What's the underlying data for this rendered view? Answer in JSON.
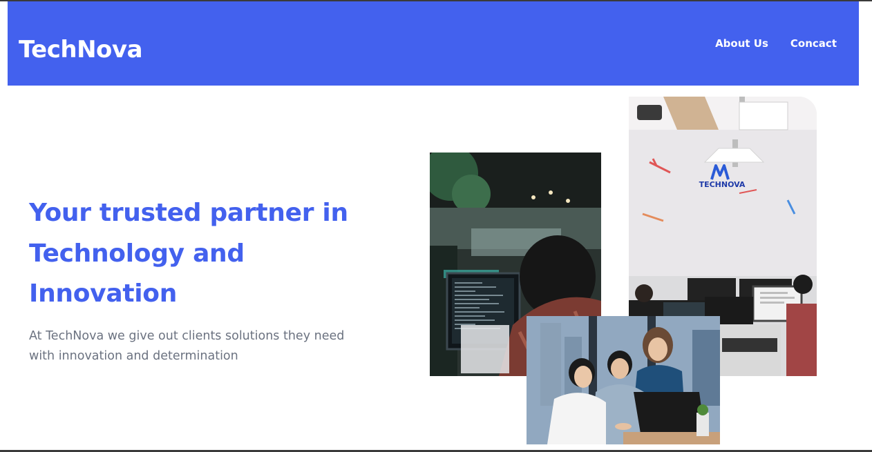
{
  "brand": {
    "name": "TechNova"
  },
  "nav": {
    "items": [
      {
        "label": "About Us"
      },
      {
        "label": "Concact"
      }
    ]
  },
  "hero": {
    "title": "Your trusted partner in Technology and Innovation",
    "subtitle": "At TechNova we give out clients solutions they need with innovation and determination"
  },
  "images": {
    "office_logo_text": "TECHNOVA",
    "office_logo_mark": "N"
  },
  "colors": {
    "primary": "#4361ee",
    "nav_text": "#ffffff",
    "body_text": "#6b7280",
    "background": "#ffffff"
  }
}
